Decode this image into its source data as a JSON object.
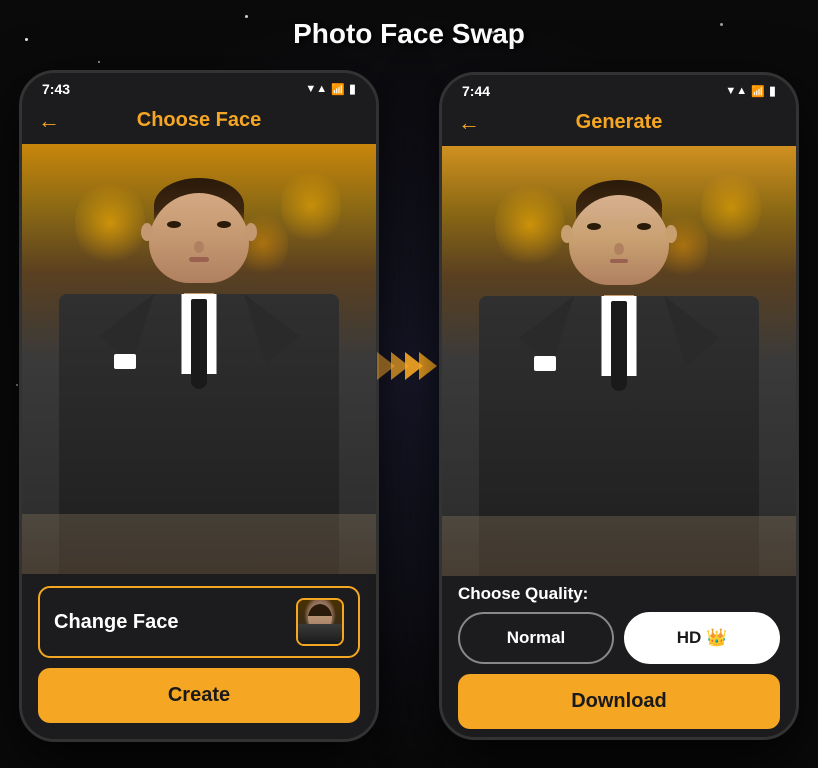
{
  "page": {
    "title": "Photo Face Swap",
    "background_color": "#0a0a0a"
  },
  "phone_left": {
    "status_bar": {
      "time": "7:43",
      "signal": "▼▲",
      "battery": "🔋"
    },
    "header": {
      "back_label": "←",
      "title": "Choose Face"
    },
    "change_face_button_label": "Change Face",
    "create_button_label": "Create"
  },
  "phone_right": {
    "status_bar": {
      "time": "7:44",
      "signal": "▼▲",
      "battery": "🔋"
    },
    "header": {
      "back_label": "←",
      "title": "Generate"
    },
    "quality_label": "Choose Quality:",
    "quality_normal_label": "Normal",
    "quality_hd_label": "HD 👑",
    "download_button_label": "Download"
  }
}
